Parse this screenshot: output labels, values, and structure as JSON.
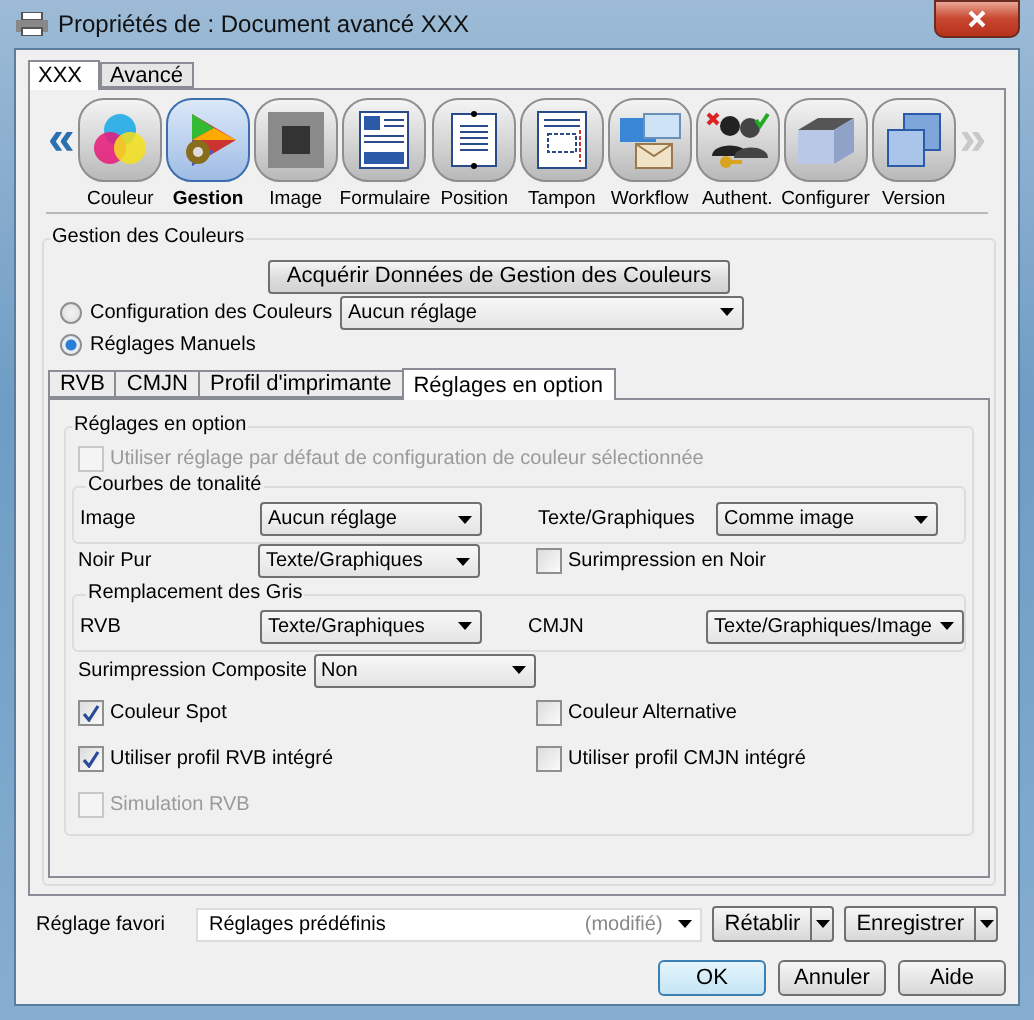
{
  "window": {
    "title": "Propriétés de : Document avancé XXX"
  },
  "tabs": [
    {
      "label": "XXX",
      "selected": true
    },
    {
      "label": "Avancé",
      "selected": false
    }
  ],
  "nav": {
    "prev": {
      "glyph": "«",
      "disabled": false
    },
    "next": {
      "glyph": "»",
      "disabled": true
    },
    "items": [
      {
        "label": "Couleur",
        "selected": false
      },
      {
        "label": "Gestion",
        "selected": true
      },
      {
        "label": "Image",
        "selected": false
      },
      {
        "label": "Formulaire",
        "selected": false
      },
      {
        "label": "Position",
        "selected": false
      },
      {
        "label": "Tampon",
        "selected": false
      },
      {
        "label": "Workflow",
        "selected": false
      },
      {
        "label": "Authent.",
        "selected": false
      },
      {
        "label": "Configurer",
        "selected": false
      },
      {
        "label": "Version",
        "selected": false
      }
    ]
  },
  "color_management": {
    "title": "Gestion des Couleurs",
    "acquire_button": "Acquérir Données de Gestion des Couleurs",
    "modes": [
      {
        "label": "Configuration des Couleurs",
        "selected": false,
        "value": "Aucun réglage"
      },
      {
        "label": "Réglages Manuels",
        "selected": true
      }
    ],
    "subtabs": [
      {
        "label": "RVB",
        "selected": false
      },
      {
        "label": "CMJN",
        "selected": false
      },
      {
        "label": "Profil d'imprimante",
        "selected": false
      },
      {
        "label": "Réglages en option",
        "selected": true
      }
    ],
    "options": {
      "title": "Réglages en option",
      "use_default": {
        "label": "Utiliser réglage par défaut de configuration de couleur sélectionnée",
        "checked": false,
        "disabled": true
      },
      "tone_curves": {
        "title": "Courbes de tonalité",
        "fields": [
          {
            "label": "Image",
            "value": "Aucun réglage"
          },
          {
            "label": "Texte/Graphiques",
            "value": "Comme image"
          }
        ]
      },
      "pure_black": {
        "label": "Noir Pur",
        "value": "Texte/Graphiques"
      },
      "black_overprint": {
        "label": "Surimpression en Noir",
        "checked": false
      },
      "gray_replacement": {
        "title": "Remplacement des Gris",
        "fields": [
          {
            "label": "RVB",
            "value": "Texte/Graphiques"
          },
          {
            "label": "CMJN",
            "value": "Texte/Graphiques/Image"
          }
        ]
      },
      "composite_overprint": {
        "label": "Surimpression Composite",
        "value": "Non"
      },
      "checks": [
        {
          "label": "Couleur Spot",
          "checked": true,
          "disabled": false
        },
        {
          "label": "Couleur Alternative",
          "checked": false,
          "disabled": false
        },
        {
          "label": "Utiliser profil RVB intégré",
          "checked": true,
          "disabled": false
        },
        {
          "label": "Utiliser profil CMJN intégré",
          "checked": false,
          "disabled": false
        },
        {
          "label": "Simulation RVB",
          "checked": false,
          "disabled": true
        }
      ]
    }
  },
  "favorite": {
    "label": "Réglage favori",
    "value": "Réglages prédéfinis",
    "note": "(modifié)",
    "buttons": [
      "Rétablir",
      "Enregistrer"
    ]
  },
  "buttons": [
    {
      "label": "OK",
      "default": true
    },
    {
      "label": "Annuler",
      "default": false
    },
    {
      "label": "Aide",
      "default": false
    }
  ]
}
